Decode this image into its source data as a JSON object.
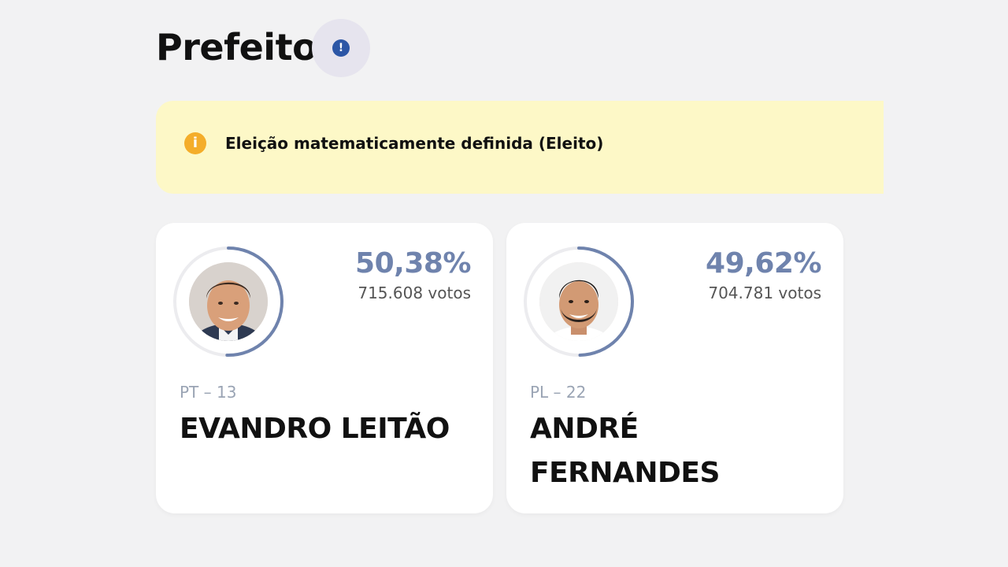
{
  "page": {
    "title": "Prefeito",
    "info_icon": "exclamation-icon",
    "alert": {
      "icon": "info-icon",
      "text": "Eleição matematicamente definida (Eleito)"
    }
  },
  "candidates": [
    {
      "percent": "50,38%",
      "votes": "715.608 votos",
      "party": "PT – 13",
      "name": "EVANDRO LEITÃO",
      "vote_share": 0.5038
    },
    {
      "percent": "49,62%",
      "votes": "704.781 votos",
      "party": "PL – 22",
      "name": "ANDRÉ FERNANDES",
      "vote_share": 0.4962
    }
  ],
  "colors": {
    "background": "#f2f2f3",
    "accent": "#6f83ad",
    "alert_bg": "#fdf8c7",
    "alert_icon": "#f4ad2a",
    "info_badge": "#2c56a6"
  }
}
